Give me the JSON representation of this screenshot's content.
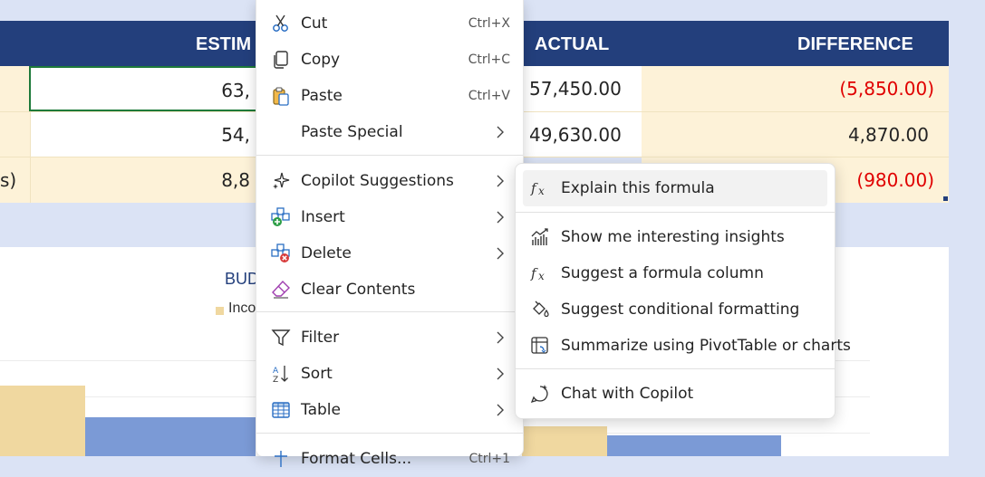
{
  "sheet": {
    "headers": {
      "estimated": "ESTIM",
      "actual": "ACTUAL",
      "difference": "DIFFERENCE"
    },
    "rows": [
      {
        "label": "",
        "estimated": "63,",
        "actual": "57,450.00",
        "difference": "(5,850.00)"
      },
      {
        "label": "",
        "estimated": "54,",
        "actual": "49,630.00",
        "difference": "4,870.00"
      },
      {
        "label": "s)",
        "estimated": "8,8",
        "actual": "",
        "difference": "(980.00)"
      }
    ],
    "chart": {
      "title_fragment": "BUD",
      "legend_fragment": "Inco"
    }
  },
  "context_menu": {
    "items": [
      {
        "id": "cut",
        "label": "Cut",
        "shortcut": "Ctrl+X",
        "icon": "scissors-icon"
      },
      {
        "id": "copy",
        "label": "Copy",
        "shortcut": "Ctrl+C",
        "icon": "copy-icon"
      },
      {
        "id": "paste",
        "label": "Paste",
        "shortcut": "Ctrl+V",
        "icon": "clipboard-icon"
      },
      {
        "id": "paste-special",
        "label": "Paste Special",
        "icon": ""
      },
      {
        "id": "copilot-suggestions",
        "label": "Copilot Suggestions",
        "icon": "copilot-sparkle-icon"
      },
      {
        "id": "insert",
        "label": "Insert",
        "icon": "insert-cells-icon"
      },
      {
        "id": "delete",
        "label": "Delete",
        "icon": "delete-cells-icon"
      },
      {
        "id": "clear-contents",
        "label": "Clear Contents",
        "icon": "eraser-icon"
      },
      {
        "id": "filter",
        "label": "Filter",
        "icon": "filter-icon"
      },
      {
        "id": "sort",
        "label": "Sort",
        "icon": "sort-az-icon"
      },
      {
        "id": "table",
        "label": "Table",
        "icon": "table-icon"
      },
      {
        "id": "format-cells",
        "label": "Format Cells...",
        "shortcut": "Ctrl+1",
        "icon": "format-cells-icon"
      }
    ]
  },
  "copilot_submenu": {
    "items": [
      {
        "id": "explain-formula",
        "label": "Explain this formula",
        "icon": "fx-icon"
      },
      {
        "id": "insights",
        "label": "Show me interesting insights",
        "icon": "insights-chart-icon"
      },
      {
        "id": "formula-column",
        "label": "Suggest a formula column",
        "icon": "fx-icon"
      },
      {
        "id": "conditional-formatting",
        "label": "Suggest conditional formatting",
        "icon": "paint-bucket-icon"
      },
      {
        "id": "pivottable",
        "label": "Summarize using PivotTable or charts",
        "icon": "pivot-table-icon"
      },
      {
        "id": "chat",
        "label": "Chat with Copilot",
        "icon": "chat-copilot-icon"
      }
    ]
  },
  "colors": {
    "header_bg": "#233f7c",
    "cream": "#fdf2d8",
    "negative": "#e00000",
    "selection": "#1e7a3a"
  }
}
